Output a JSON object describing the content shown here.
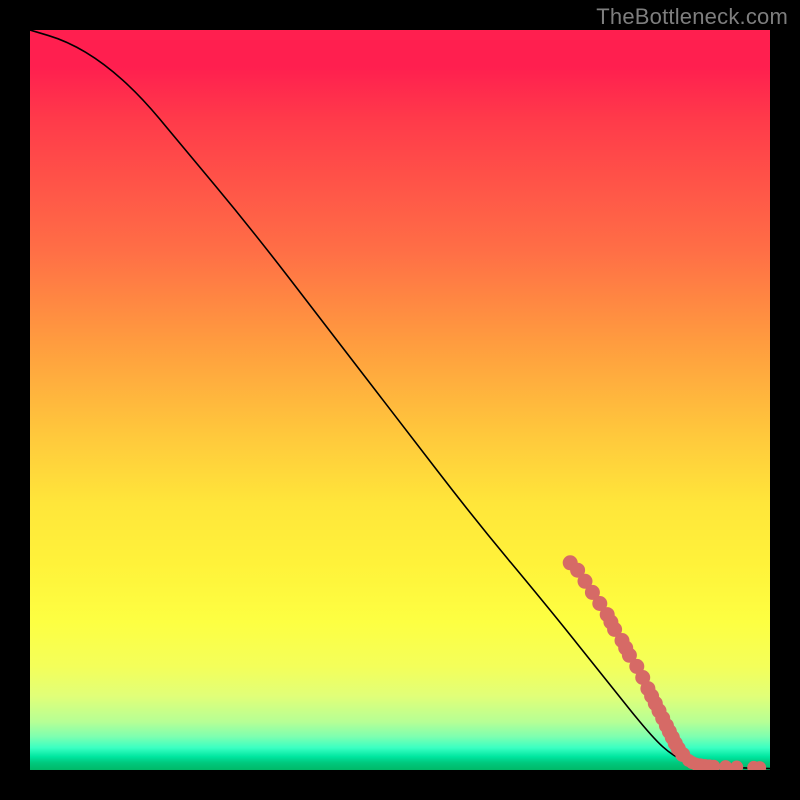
{
  "watermark": "TheBottleneck.com",
  "chart_data": {
    "type": "line",
    "title": "",
    "xlabel": "",
    "ylabel": "",
    "xlim": [
      0,
      100
    ],
    "ylim": [
      0,
      100
    ],
    "grid": false,
    "legend": false,
    "background": "heatmap-gradient",
    "curve": [
      {
        "x": 0,
        "y": 100
      },
      {
        "x": 5,
        "y": 98.5
      },
      {
        "x": 10,
        "y": 95.5
      },
      {
        "x": 15,
        "y": 91
      },
      {
        "x": 20,
        "y": 85
      },
      {
        "x": 30,
        "y": 73
      },
      {
        "x": 40,
        "y": 60
      },
      {
        "x": 50,
        "y": 47
      },
      {
        "x": 60,
        "y": 34
      },
      {
        "x": 70,
        "y": 22
      },
      {
        "x": 78,
        "y": 12
      },
      {
        "x": 84,
        "y": 4.5
      },
      {
        "x": 87,
        "y": 1.8
      },
      {
        "x": 90,
        "y": 0.6
      },
      {
        "x": 95,
        "y": 0.3
      },
      {
        "x": 100,
        "y": 0.2
      }
    ],
    "series": [
      {
        "name": "markers",
        "type": "scatter",
        "color": "#d66a66",
        "points": [
          {
            "x": 73,
            "y": 28
          },
          {
            "x": 74,
            "y": 27
          },
          {
            "x": 75,
            "y": 25.5
          },
          {
            "x": 76,
            "y": 24
          },
          {
            "x": 77,
            "y": 22.5
          },
          {
            "x": 78,
            "y": 21
          },
          {
            "x": 78.5,
            "y": 20
          },
          {
            "x": 79,
            "y": 19
          },
          {
            "x": 80,
            "y": 17.5
          },
          {
            "x": 80.5,
            "y": 16.5
          },
          {
            "x": 81,
            "y": 15.5
          },
          {
            "x": 82,
            "y": 14
          },
          {
            "x": 82.8,
            "y": 12.5
          },
          {
            "x": 83.5,
            "y": 11
          },
          {
            "x": 84,
            "y": 10
          },
          {
            "x": 84.5,
            "y": 9
          },
          {
            "x": 85,
            "y": 8
          },
          {
            "x": 85.5,
            "y": 7
          },
          {
            "x": 86,
            "y": 6
          },
          {
            "x": 86.4,
            "y": 5.2
          },
          {
            "x": 86.8,
            "y": 4.4
          },
          {
            "x": 87.2,
            "y": 3.6
          },
          {
            "x": 87.6,
            "y": 2.9
          },
          {
            "x": 88.2,
            "y": 2.1
          },
          {
            "x": 89.0,
            "y": 1.3
          },
          {
            "x": 89.5,
            "y": 1.0
          },
          {
            "x": 90.0,
            "y": 0.8
          },
          {
            "x": 90.6,
            "y": 0.7
          },
          {
            "x": 91.2,
            "y": 0.6
          },
          {
            "x": 91.8,
            "y": 0.55
          },
          {
            "x": 92.4,
            "y": 0.5
          },
          {
            "x": 94.0,
            "y": 0.45
          },
          {
            "x": 95.5,
            "y": 0.4
          },
          {
            "x": 97.8,
            "y": 0.35
          },
          {
            "x": 98.6,
            "y": 0.32
          }
        ]
      }
    ]
  }
}
